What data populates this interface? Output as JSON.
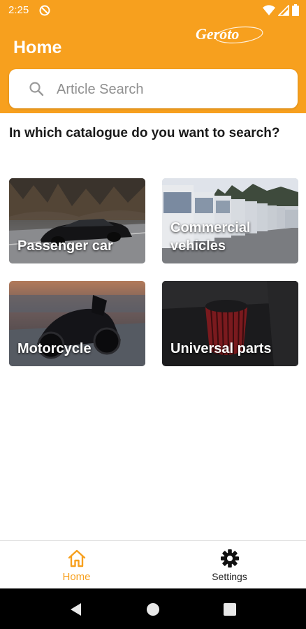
{
  "status_bar": {
    "time": "2:25"
  },
  "header": {
    "title": "Home",
    "brand": "Geroto",
    "accent_color": "#f7a01e"
  },
  "search": {
    "placeholder": "Article Search",
    "value": ""
  },
  "main": {
    "question": "In which catalogue do you want to search?",
    "catalogues": [
      {
        "label": "Passenger car"
      },
      {
        "label": "Commercial vehicles"
      },
      {
        "label": "Motorcycle"
      },
      {
        "label": "Universal parts"
      }
    ]
  },
  "bottom_nav": {
    "items": [
      {
        "label": "Home",
        "icon": "home-icon",
        "active": true
      },
      {
        "label": "Settings",
        "icon": "gear-icon",
        "active": false
      }
    ]
  },
  "system_nav": {
    "icons": [
      "back-icon",
      "home-circle-icon",
      "recents-icon"
    ]
  }
}
